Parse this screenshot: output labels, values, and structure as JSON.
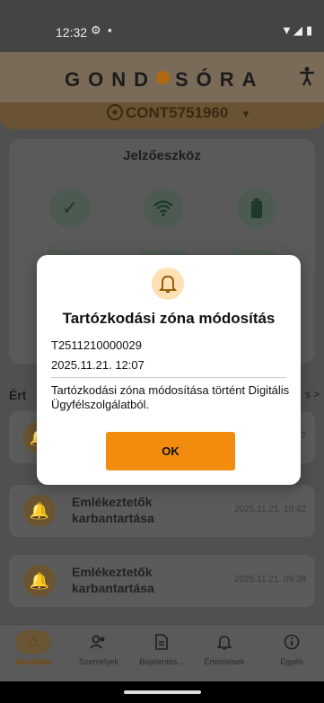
{
  "status_bar": {
    "time": "12:32"
  },
  "header": {
    "logo_left": "GOND",
    "logo_right": "SÓRA"
  },
  "device": {
    "id": "CONT5751960"
  },
  "indicator_card": {
    "title": "Jelzőeszköz",
    "items": [
      {
        "label": "Státusz"
      },
      {
        "label": "Jelerősség"
      },
      {
        "label": "Töltöttség"
      }
    ]
  },
  "notifications_section": {
    "label_visible": "Ért",
    "link_visible": "s >"
  },
  "notifications": [
    {
      "title": "",
      "date": "07"
    },
    {
      "title": "Emlékeztetők karbantartása",
      "date": "2025.11.21. 10:42"
    },
    {
      "title": "Emlékeztetők karbantartása",
      "date": "2025.11.21. 09:38"
    }
  ],
  "bottom_nav": [
    {
      "label": "Kezdőlap",
      "icon": "home-icon",
      "active": true
    },
    {
      "label": "Személyek",
      "icon": "people-icon",
      "active": false
    },
    {
      "label": "Bejelentés...",
      "icon": "document-icon",
      "active": false
    },
    {
      "label": "Értesítések",
      "icon": "bell-icon",
      "active": false
    },
    {
      "label": "Egyéb",
      "icon": "info-icon",
      "active": false
    }
  ],
  "dialog": {
    "title": "Tartózkodási zóna módosítás",
    "id": "T2511210000029",
    "date": "2025.11.21. 12:07",
    "message": "Tartózkodási zóna módosítása történt Digitális Ügyfélszolgálatból.",
    "ok_label": "OK"
  },
  "colors": {
    "accent": "#f28c0f",
    "icon_bg": "#fde1b4"
  }
}
